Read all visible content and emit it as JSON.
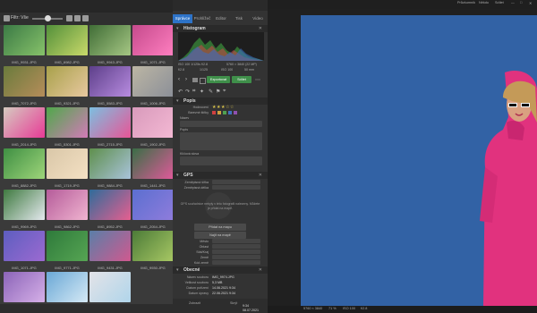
{
  "left_toolbar": {
    "filter_label": "Filtr: Vše"
  },
  "thumbnails": [
    {
      "name": "IMG_9931.JPG",
      "color": "#3b7a45",
      "accent": "#87c26a"
    },
    {
      "name": "IMG_6982.JPG",
      "color": "#53903a",
      "accent": "#c9d96a"
    },
    {
      "name": "IMG_9943.JPG",
      "color": "#406d36",
      "accent": "#a6c784"
    },
    {
      "name": "IMG_1071.JPG",
      "color": "#c54a8c",
      "accent": "#ff7fc0"
    },
    {
      "name": "IMG_7072.JPG",
      "color": "#6a7b3c",
      "accent": "#b68d5a"
    },
    {
      "name": "IMG_9321.JPG",
      "color": "#a8a14a",
      "accent": "#e8c8a0"
    },
    {
      "name": "IMG_5583.JPG",
      "color": "#5d3f8a",
      "accent": "#b88ce0"
    },
    {
      "name": "IMG_1006.JPG",
      "color": "#bcb6a4",
      "accent": "#8b8f98"
    },
    {
      "name": "IMG_2014.JPG",
      "color": "#d5cbc0",
      "accent": "#e83a96"
    },
    {
      "name": "IMG_5301.JPG",
      "color": "#4fa84a",
      "accent": "#d27bb8"
    },
    {
      "name": "IMG_2715.JPG",
      "color": "#7cbfe0",
      "accent": "#e85596"
    },
    {
      "name": "IMG_1902.JPG",
      "color": "#d89abb",
      "accent": "#f4b9d4"
    },
    {
      "name": "IMG_8882.JPG",
      "color": "#3f8f43",
      "accent": "#9ed57a"
    },
    {
      "name": "IMG_1719.JPG",
      "color": "#d9c7a8",
      "accent": "#f4e0c3"
    },
    {
      "name": "IMG_9884.JPG",
      "color": "#5e8f4c",
      "accent": "#a9c3db"
    },
    {
      "name": "IMG_1441.JPG",
      "color": "#3a6e46",
      "accent": "#e05a9a"
    },
    {
      "name": "IMG_9969.JPG",
      "color": "#3f7a40",
      "accent": "#e4e9ee"
    },
    {
      "name": "IMG_9862.JPG",
      "color": "#b55c9a",
      "accent": "#f0b4d0"
    },
    {
      "name": "IMG_8952.JPG",
      "color": "#2f6c9a",
      "accent": "#e65f90"
    },
    {
      "name": "IMG_2054.JPG",
      "color": "#5b6fd0",
      "accent": "#8f7cdc"
    },
    {
      "name": "IMG_1071.JPG",
      "color": "#5d5ec0",
      "accent": "#9c6ad1"
    },
    {
      "name": "IMG_9771.JPG",
      "color": "#2e7a3b",
      "accent": "#56a553"
    },
    {
      "name": "IMG_9431.JPG",
      "color": "#5a7fa8",
      "accent": "#d0598f"
    },
    {
      "name": "IMG_9930.JPG",
      "color": "#4c7b38",
      "accent": "#a8c864"
    },
    {
      "name": "IMG_1055.JPG",
      "color": "#8b64b8",
      "accent": "#d6b0e8"
    },
    {
      "name": "IMG_3210.JPG",
      "color": "#6aa8d6",
      "accent": "#d5e9f5"
    },
    {
      "name": "IMG_4010.JPG",
      "color": "#e3e3e8",
      "accent": "#b0d5ea"
    }
  ],
  "tabs": [
    "Správce",
    "Prohlížeč",
    "Editor",
    "Tisk",
    "Video"
  ],
  "histogram": {
    "title": "Histogram",
    "info_left": "ISO 100  1/125s  f/2.8",
    "info_right": "5760 × 3840 (22 MP)",
    "values": [
      "f/2.8",
      "1/125",
      "ISO 100",
      "50 mm"
    ]
  },
  "actions": {
    "export_label": "Exportovat",
    "share_label": "Sdílet"
  },
  "popis": {
    "title": "Popis",
    "fields": [
      "Hodnocení",
      "Barevné štítky",
      "Název",
      "Popis",
      "Klíčová slova"
    ]
  },
  "gps": {
    "title": "GPS",
    "fields": [
      "Zeměpisná šířka",
      "Zeměpisná délka"
    ],
    "note": "GPS souřadnice nebyly v této fotografii nalezeny. Můžete je přidat na mapě."
  },
  "map_buttons": [
    "Přidat na mapu",
    "Najít na mapě"
  ],
  "location_fields": [
    "Město",
    "Oblast",
    "Stát/Kraj",
    "Země",
    "Kód země"
  ],
  "obecne": {
    "title": "Obecné",
    "fields": [
      {
        "label": "Název souboru",
        "value": "IMG_9974.JPG"
      },
      {
        "label": "Velikost souboru",
        "value": "5,3 MB"
      },
      {
        "label": "Datum pořízení",
        "value": "14.06.2021 9:34"
      },
      {
        "label": "Datum úpravy",
        "value": "22.06.2021 9:34"
      }
    ]
  },
  "mid_footer": {
    "left": "Zobrazit",
    "right": "Skrýt"
  },
  "right_toolbar": {
    "items": [
      "Průzkumník",
      "Někdo",
      "Sdílet",
      "—",
      "□",
      "✕"
    ]
  },
  "right_status": {
    "items": [
      "5760 × 3840",
      "71 %",
      "ISO 100",
      "f/2.8"
    ]
  },
  "taskbar": {
    "time": "9:34",
    "date": "08.07.2021"
  },
  "colors": {
    "accent": "#2d73c8",
    "photo_bg": "#2f5fa0",
    "top_title": "#dcdcdc"
  }
}
